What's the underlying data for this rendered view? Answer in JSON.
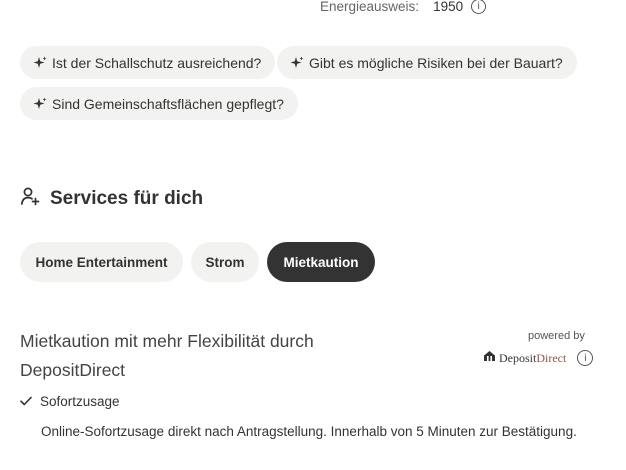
{
  "energy": {
    "label": "Energieausweis:",
    "value": "1950"
  },
  "prompts": [
    {
      "label": "Ist der Schallschutz ausreichend?"
    },
    {
      "label": "Gibt es mögliche Risiken bei der Bauart?"
    },
    {
      "label": "Sind Gemeinschaftsflächen gepflegt?"
    }
  ],
  "services": {
    "title": "Services für dich",
    "tabs": [
      {
        "label": "Home Entertainment",
        "active": false
      },
      {
        "label": "Strom",
        "active": false
      },
      {
        "label": "Mietkaution",
        "active": true
      }
    ]
  },
  "offer": {
    "title": "Mietkaution mit mehr Flexibilität durch DepositDirect",
    "powered_by": "powered by",
    "provider": {
      "part1": "Deposit",
      "part2": "Direct"
    },
    "feature": "Sofortzusage",
    "description": "Online-Sofortzusage direkt nach Antragstellung. Innerhalb von 5 Minuten zur Bestätigung."
  },
  "colors": {
    "chip_bg": "#f2f2f0",
    "active_tab_bg": "#333333",
    "text": "#333333"
  }
}
